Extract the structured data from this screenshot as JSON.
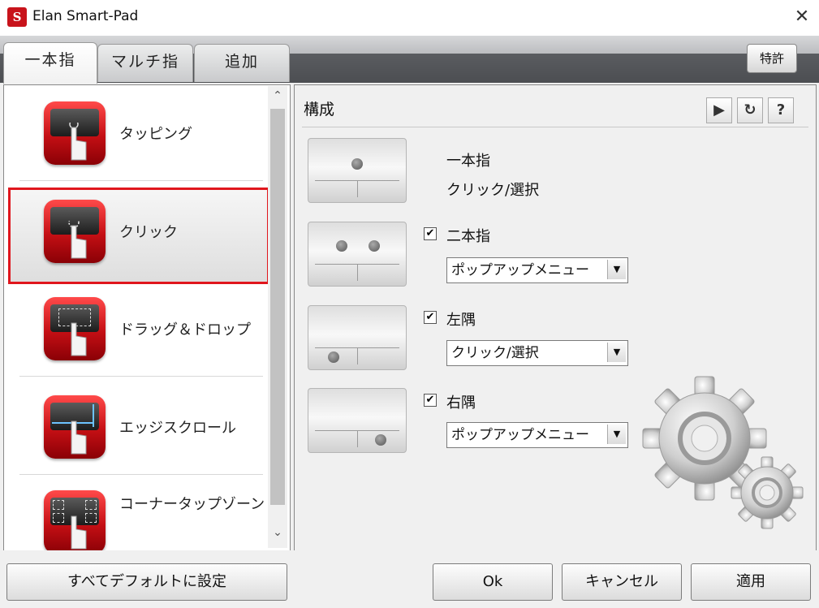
{
  "window": {
    "title": "Elan Smart-Pad",
    "logo_text": "S",
    "close_glyph": "✕"
  },
  "tabs": [
    {
      "label": "一本指",
      "active": true
    },
    {
      "label": "マルチ指",
      "active": false
    },
    {
      "label": "追加",
      "active": false
    }
  ],
  "patent_button": "特許",
  "gesture_list": {
    "items": [
      {
        "label": "タッピング",
        "icon": "tapping-icon"
      },
      {
        "label": "クリック",
        "icon": "click-icon",
        "selected": true
      },
      {
        "label": "ドラッグ＆ドロップ",
        "icon": "drag-drop-icon"
      },
      {
        "label": "エッジスクロール",
        "icon": "edge-scroll-icon"
      },
      {
        "label": "コーナータップゾーン",
        "icon": "corner-tap-icon"
      }
    ],
    "scroll_up": "⌃",
    "scroll_down": "⌄"
  },
  "config": {
    "title": "構成",
    "toolbar": {
      "play": "▶",
      "reset": "↻",
      "help": "?"
    },
    "one_finger": {
      "label": "一本指",
      "action": "クリック/選択"
    },
    "two_finger": {
      "label": "二本指",
      "checked": true,
      "value": "ポップアップメニュー"
    },
    "left_corner": {
      "label": "左隅",
      "checked": true,
      "value": "クリック/選択"
    },
    "right_corner": {
      "label": "右隅",
      "checked": true,
      "value": "ポップアップメニュー"
    },
    "check_glyph": "✔",
    "dropdown_glyph": "▼"
  },
  "buttons": {
    "defaults": "すべてデフォルトに設定",
    "ok": "Ok",
    "cancel": "キャンセル",
    "apply": "適用"
  },
  "colors": {
    "accent": "#e0161d",
    "icon_red": "#c40f14"
  }
}
